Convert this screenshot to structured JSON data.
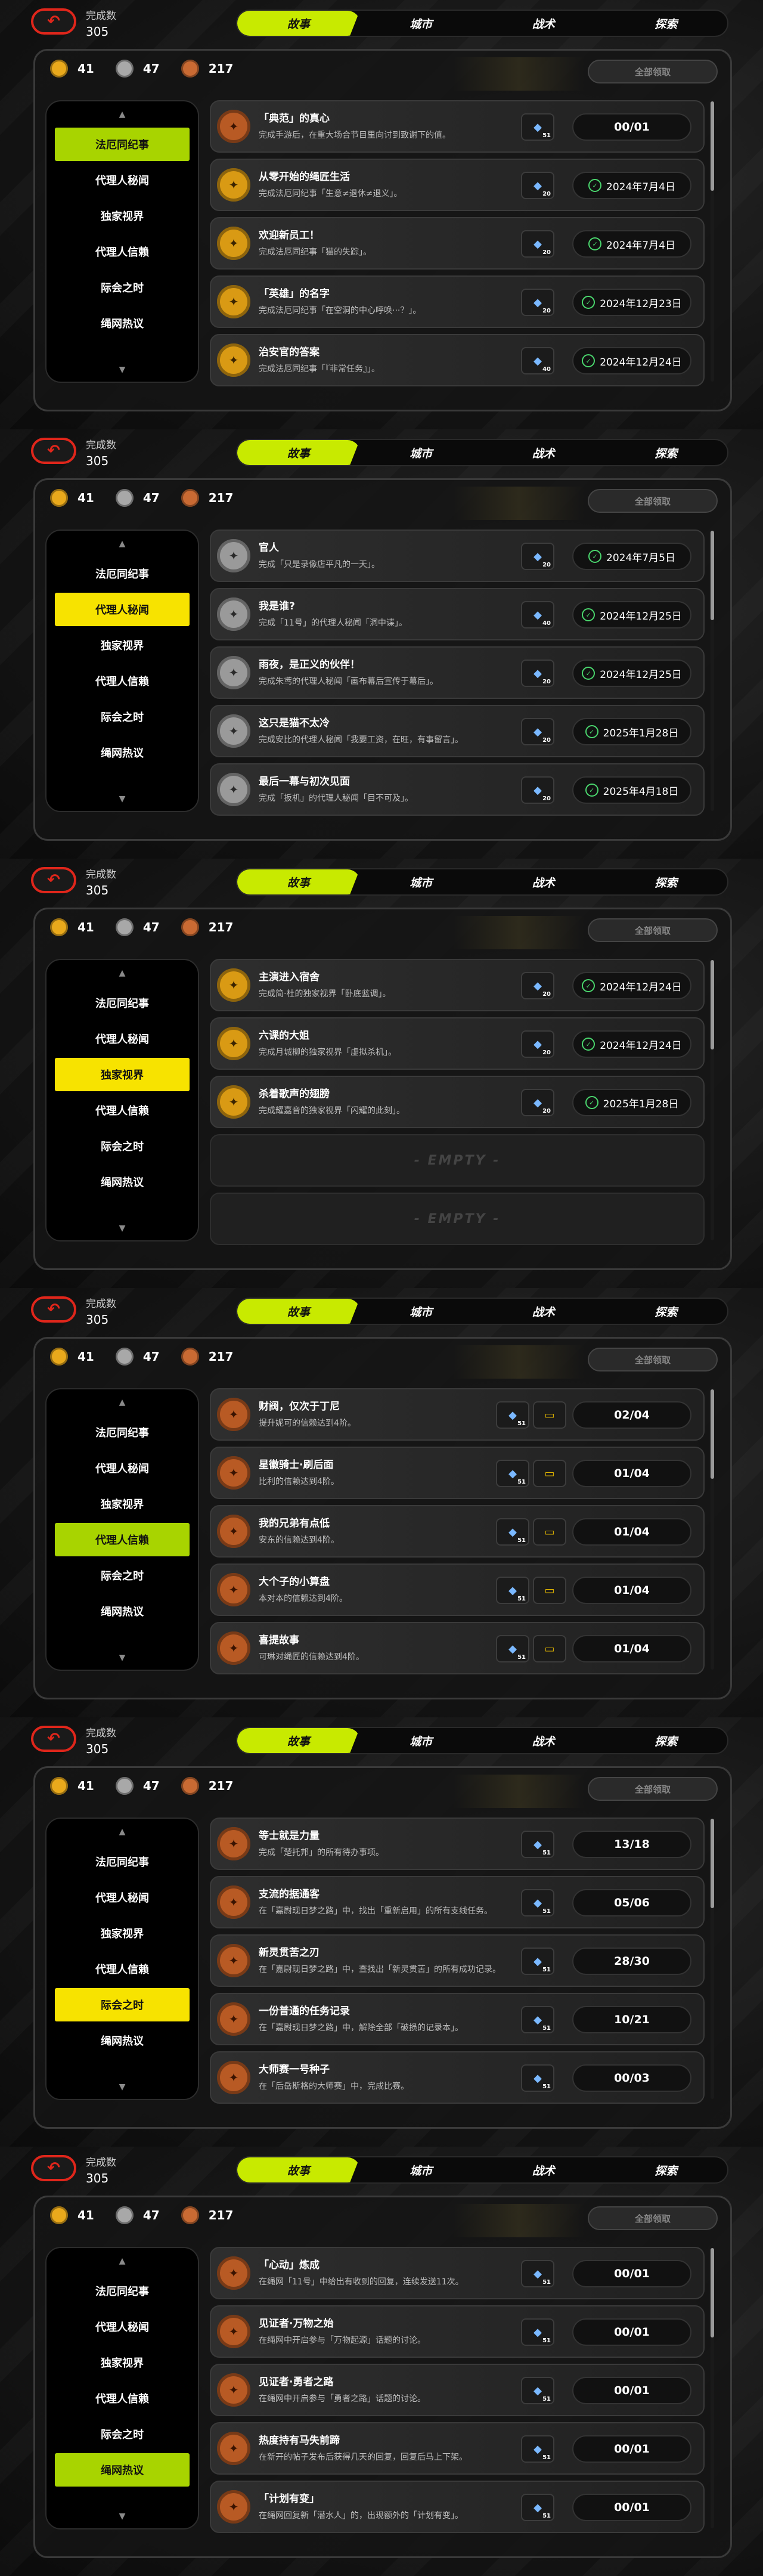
{
  "common": {
    "counter_label": "完成数",
    "counter_value": "305",
    "currencies": [
      {
        "icon": "gold-coin-icon",
        "value": "41"
      },
      {
        "icon": "silver-coin-icon",
        "value": "47"
      },
      {
        "icon": "copper-coin-icon",
        "value": "217"
      }
    ],
    "claim_all": "全部领取",
    "tabs": [
      "故事",
      "城市",
      "战术",
      "探索"
    ],
    "categories": [
      "法厄同纪事",
      "代理人秘闻",
      "独家视界",
      "代理人信赖",
      "际会之时",
      "绳网热议"
    ]
  },
  "panels": [
    {
      "active_category": 0,
      "highlight": "green",
      "cards": [
        {
          "medal": "copper",
          "title": "「典范」的真心",
          "desc": "完成手游后，在重大场合节目里向讨到致谢下的值。",
          "reward": {
            "icon": "ticket-icon",
            "count": "51"
          },
          "status_type": "progress",
          "status": "00/01"
        },
        {
          "medal": "gold",
          "title": "从零开始的绳匠生活",
          "desc": "完成法厄同纪事「生意≠退休≠退义」。",
          "reward": {
            "icon": "ticket-icon",
            "count": "20"
          },
          "status_type": "date",
          "status": "2024年7月4日"
        },
        {
          "medal": "gold",
          "title": "欢迎新员工！",
          "desc": "完成法厄同纪事「猫的失踪」。",
          "reward": {
            "icon": "ticket-icon",
            "count": "20"
          },
          "status_type": "date",
          "status": "2024年7月4日"
        },
        {
          "medal": "gold",
          "title": "「英雄」的名字",
          "desc": "完成法厄同纪事「在空洞的中心呼唤···？」。",
          "reward": {
            "icon": "ticket-icon",
            "count": "20"
          },
          "status_type": "date",
          "status": "2024年12月23日"
        },
        {
          "medal": "gold",
          "title": "治安官的答案",
          "desc": "完成法厄同纪事「『非常任务』」。",
          "reward": {
            "icon": "ticket-icon",
            "count": "40"
          },
          "status_type": "date",
          "status": "2024年12月24日"
        }
      ]
    },
    {
      "active_category": 1,
      "highlight": "yellow",
      "cards": [
        {
          "medal": "silver",
          "title": "官人",
          "desc": "完成「只是录像店平凡的一天」。",
          "reward": {
            "icon": "ticket-icon",
            "count": "20"
          },
          "status_type": "date",
          "status": "2024年7月5日"
        },
        {
          "medal": "silver",
          "title": "我是谁?",
          "desc": "完成「11号」的代理人秘闻「洞中谍」。",
          "reward": {
            "icon": "ticket-icon",
            "count": "40"
          },
          "status_type": "date",
          "status": "2024年12月25日"
        },
        {
          "medal": "silver",
          "title": "雨夜，是正义的伙伴！",
          "desc": "完成朱鸢的代理人秘闻「画布幕后宣传于幕后」。",
          "reward": {
            "icon": "ticket-icon",
            "count": "20"
          },
          "status_type": "date",
          "status": "2024年12月25日"
        },
        {
          "medal": "silver",
          "title": "这只是猫不太冷",
          "desc": "完成安比的代理人秘闻「我要工资，在旺，有事留言」。",
          "reward": {
            "icon": "ticket-icon",
            "count": "20"
          },
          "status_type": "date",
          "status": "2025年1月28日"
        },
        {
          "medal": "silver",
          "title": "最后一幕与初次见面",
          "desc": "完成「扳机」的代理人秘闻「目不可及」。",
          "reward": {
            "icon": "ticket-icon",
            "count": "20"
          },
          "status_type": "date",
          "status": "2025年4月18日"
        }
      ]
    },
    {
      "active_category": 2,
      "highlight": "yellow",
      "cards": [
        {
          "medal": "gold",
          "title": "主演进入宿舍",
          "desc": "完成简·杜的独家视界「卧底蓝调」。",
          "reward": {
            "icon": "ticket-icon",
            "count": "20"
          },
          "status_type": "date",
          "status": "2024年12月24日"
        },
        {
          "medal": "gold",
          "title": "六课的大姐",
          "desc": "完成月城柳的独家视界「虚拟杀机」。",
          "reward": {
            "icon": "ticket-icon",
            "count": "20"
          },
          "status_type": "date",
          "status": "2024年12月24日"
        },
        {
          "medal": "gold",
          "title": "杀着歌声的翅膀",
          "desc": "完成耀嘉音的独家视界「闪耀的此刻」。",
          "reward": {
            "icon": "ticket-icon",
            "count": "20"
          },
          "status_type": "date",
          "status": "2025年1月28日"
        },
        {
          "empty": true,
          "label": "- EMPTY -"
        },
        {
          "empty": true,
          "label": "- EMPTY -"
        }
      ]
    },
    {
      "active_category": 3,
      "highlight": "green",
      "cards": [
        {
          "medal": "copper",
          "title": "财阀，仅次于丁尼",
          "desc": "提升妮可的信赖达到4阶。",
          "reward": {
            "icon": "ticket-icon",
            "count": "51"
          },
          "reward2": "film-icon",
          "status_type": "progress",
          "status": "02/04"
        },
        {
          "medal": "copper",
          "title": "星徽骑士·刷后面",
          "desc": "比利的信赖达到4阶。",
          "reward": {
            "icon": "ticket-icon",
            "count": "51"
          },
          "reward2": "film-icon",
          "status_type": "progress",
          "status": "01/04"
        },
        {
          "medal": "copper",
          "title": "我的兄弟有点低",
          "desc": "安东的信赖达到4阶。",
          "reward": {
            "icon": "ticket-icon",
            "count": "51"
          },
          "reward2": "film-icon",
          "status_type": "progress",
          "status": "01/04"
        },
        {
          "medal": "copper",
          "title": "大个子的小算盘",
          "desc": "本对本的信赖达到4阶。",
          "reward": {
            "icon": "ticket-icon",
            "count": "51"
          },
          "reward2": "film-icon",
          "status_type": "progress",
          "status": "01/04"
        },
        {
          "medal": "copper",
          "title": "喜提故事",
          "desc": "可琳对绳匠的信赖达到4阶。",
          "reward": {
            "icon": "ticket-icon",
            "count": "51"
          },
          "reward2": "film-icon",
          "status_type": "progress",
          "status": "01/04"
        }
      ]
    },
    {
      "active_category": 4,
      "highlight": "yellow",
      "cards": [
        {
          "medal": "copper",
          "title": "等士就是力量",
          "desc": "完成「楚托邦」的所有待办事项。",
          "reward": {
            "icon": "ticket-icon",
            "count": "51"
          },
          "status_type": "progress",
          "status": "13/18"
        },
        {
          "medal": "copper",
          "title": "支流的据通客",
          "desc": "在「嘉尉现日梦之路」中，找出「重新启用」的所有支线任务。",
          "reward": {
            "icon": "ticket-icon",
            "count": "51"
          },
          "status_type": "progress",
          "status": "05/06"
        },
        {
          "medal": "copper",
          "title": "新灵贯苦之刃",
          "desc": "在「嘉尉现日梦之路」中，查找出「新灵贯苦」的所有成功记录。",
          "reward": {
            "icon": "ticket-icon",
            "count": "51"
          },
          "status_type": "progress",
          "status": "28/30"
        },
        {
          "medal": "copper",
          "title": "一份普通的任务记录",
          "desc": "在「嘉尉现日梦之路」中，解除全部「破损的记录本」。",
          "reward": {
            "icon": "ticket-icon",
            "count": "51"
          },
          "status_type": "progress",
          "status": "10/21"
        },
        {
          "medal": "copper",
          "title": "大师赛一号种子",
          "desc": "在「后岳斯格的大师赛」中，完成比赛。",
          "reward": {
            "icon": "ticket-icon",
            "count": "51"
          },
          "status_type": "progress",
          "status": "00/03"
        }
      ]
    },
    {
      "active_category": 5,
      "highlight": "green",
      "cards": [
        {
          "medal": "copper",
          "title": "「心动」炼成",
          "desc": "在绳网「11号」中给出有收到的回复，连续发送11次。",
          "reward": {
            "icon": "ticket-icon",
            "count": "51"
          },
          "status_type": "progress",
          "status": "00/01"
        },
        {
          "medal": "copper",
          "title": "见证者·万物之始",
          "desc": "在绳网中开启参与「万物起源」话题的讨论。",
          "reward": {
            "icon": "ticket-icon",
            "count": "51"
          },
          "status_type": "progress",
          "status": "00/01"
        },
        {
          "medal": "copper",
          "title": "见证者·勇者之路",
          "desc": "在绳网中开启参与「勇者之路」话题的讨论。",
          "reward": {
            "icon": "ticket-icon",
            "count": "51"
          },
          "status_type": "progress",
          "status": "00/01"
        },
        {
          "medal": "copper",
          "title": "热度持有马失前蹄",
          "desc": "在新开的帖子发布后获得几天的回复，回复后马上下架。",
          "reward": {
            "icon": "ticket-icon",
            "count": "51"
          },
          "status_type": "progress",
          "status": "00/01"
        },
        {
          "medal": "copper",
          "title": "「计划有变」",
          "desc": "在绳网回复新「潜水人」的，出现额外的「计划有变」。",
          "reward": {
            "icon": "ticket-icon",
            "count": "51"
          },
          "status_type": "progress",
          "status": "00/01"
        }
      ]
    }
  ]
}
